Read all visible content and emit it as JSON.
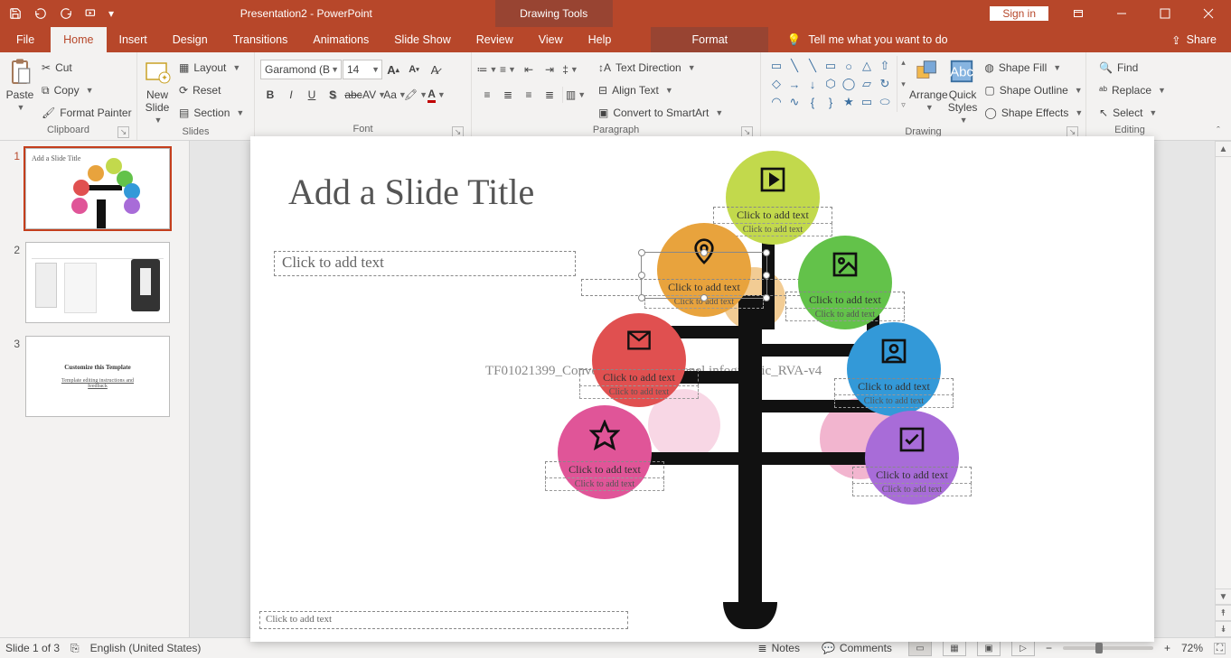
{
  "titlebar": {
    "doc_title": "Presentation2 - PowerPoint",
    "tool_tab": "Drawing Tools",
    "sign_in": "Sign in"
  },
  "tabs": {
    "file": "File",
    "home": "Home",
    "insert": "Insert",
    "design": "Design",
    "transitions": "Transitions",
    "animations": "Animations",
    "slideshow": "Slide Show",
    "review": "Review",
    "view": "View",
    "help": "Help",
    "format": "Format",
    "tell_me": "Tell me what you want to do",
    "share": "Share"
  },
  "ribbon": {
    "clipboard": {
      "label": "Clipboard",
      "paste": "Paste",
      "cut": "Cut",
      "copy": "Copy",
      "format_painter": "Format Painter"
    },
    "slides": {
      "label": "Slides",
      "new_slide": "New\nSlide",
      "layout": "Layout",
      "reset": "Reset",
      "section": "Section"
    },
    "font": {
      "label": "Font",
      "name": "Garamond (B",
      "size": "14"
    },
    "paragraph": {
      "label": "Paragraph",
      "text_direction": "Text Direction",
      "align_text": "Align Text",
      "smartart": "Convert to SmartArt"
    },
    "drawing": {
      "label": "Drawing",
      "arrange": "Arrange",
      "quick_styles": "Quick\nStyles",
      "shape_fill": "Shape Fill",
      "shape_outline": "Shape Outline",
      "shape_effects": "Shape Effects"
    },
    "editing": {
      "label": "Editing",
      "find": "Find",
      "replace": "Replace",
      "select": "Select"
    }
  },
  "thumbs": {
    "s1_title": "Add a Slide Title",
    "s3_title": "Customize this Template",
    "s3_sub": "Template editing instructions and feedback"
  },
  "slide": {
    "title": "Add a Slide Title",
    "body": "Click to add text",
    "footer": "Click to add text",
    "watermark": "TF01021399_Conveyor belt multi-panel infographic_RVA-v4",
    "node_main": "Click to add text",
    "node_sub": "Click to add text"
  },
  "status": {
    "slide": "Slide 1 of 3",
    "lang": "English (United States)",
    "notes": "Notes",
    "comments": "Comments",
    "zoom": "72%"
  }
}
